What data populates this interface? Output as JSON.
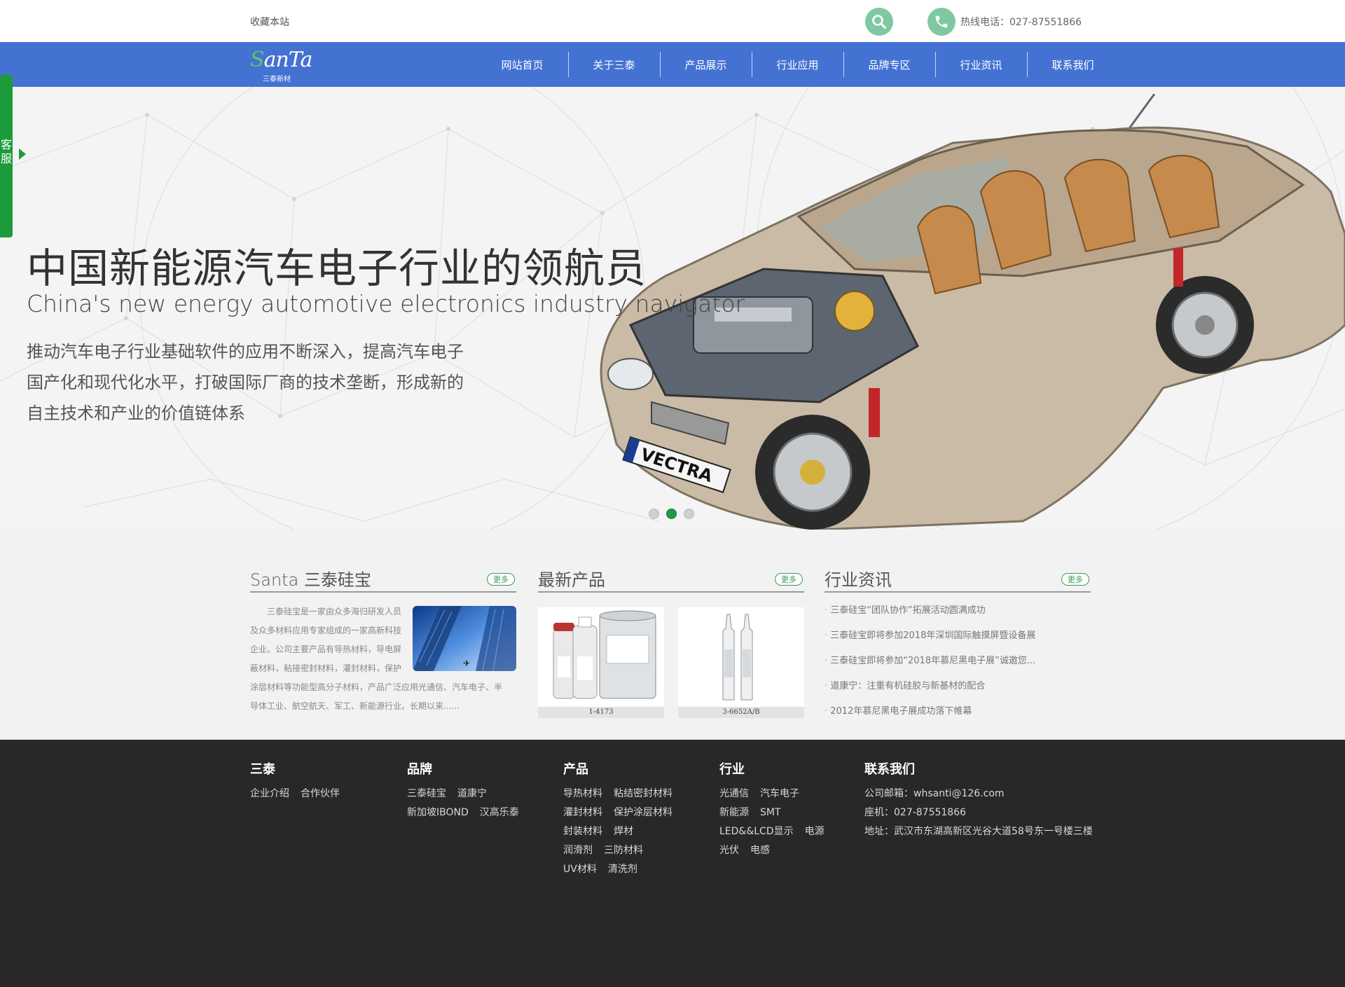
{
  "topbar": {
    "favorite": "收藏本站",
    "hotline": "热线电话：027-87551866"
  },
  "brand": {
    "logo_text": "SanTa",
    "logo_sub": "三泰新材"
  },
  "nav": {
    "items": [
      "网站首页",
      "关于三泰",
      "产品展示",
      "行业应用",
      "品牌专区",
      "行业资讯",
      "联系我们"
    ]
  },
  "side_service": {
    "label": "客服"
  },
  "hero": {
    "title": "中国新能源汽车电子行业的领航员",
    "subtitle": "China's new energy automotive electronics industry navigator",
    "desc_lines": [
      "推动汽车电子行业基础软件的应用不断深入，提高汽车电子",
      "国产化和现代化水平，打破国际厂商的技术垄断，形成新的",
      "自主技术和产业的价值链体系"
    ],
    "car_plate": "VECTRA",
    "slides": 3,
    "active_slide": 2
  },
  "about": {
    "title": "Santa 三泰硅宝",
    "more": "更多",
    "text": "三泰硅宝是一家由众多海归研发人员及众多材料应用专家组成的一家高新科技企业。公司主要产品有导热材料，导电屏蔽材料，粘接密封材料，灌封材料，保护涂层材料等功能型高分子材料，产品广泛应用光通信、汽车电子、半导体工业、航空航天、军工、新能源行业。长期以来......"
  },
  "products": {
    "title": "最新产品",
    "more": "更多",
    "items": [
      {
        "caption": "1-4173"
      },
      {
        "caption": "3-6652A/B"
      }
    ]
  },
  "news": {
    "title": "行业资讯",
    "more": "更多",
    "items": [
      "三泰硅宝“团队协作”拓展活动圆满成功",
      "三泰硅宝即将参加2018年深圳国际触摸屏暨设备展",
      "三泰硅宝即将参加“2018年慕尼黑电子展”诚邀您...",
      "道康宁：注重有机硅胶与新基材的配合",
      "2012年慕尼黑电子展成功落下帷幕"
    ]
  },
  "footer": {
    "sections": [
      {
        "title": "三泰",
        "rows": [
          [
            "企业介绍",
            "合作伙伴"
          ]
        ]
      },
      {
        "title": "品牌",
        "rows": [
          [
            "三泰硅宝",
            "道康宁"
          ],
          [
            "新加坡IBOND",
            "汉高乐泰"
          ]
        ]
      },
      {
        "title": "产品",
        "rows": [
          [
            "导热材料",
            "粘结密封材料"
          ],
          [
            "灌封材料",
            "保护涂层材料"
          ],
          [
            "封装材料",
            "焊材"
          ],
          [
            "润滑剂",
            "三防材料"
          ],
          [
            "UV材料",
            "清洗剂"
          ]
        ]
      },
      {
        "title": "行业",
        "rows": [
          [
            "光通信",
            "汽车电子"
          ],
          [
            "新能源",
            "SMT"
          ],
          [
            "LED&&LCD显示",
            "电源"
          ],
          [
            "光伏",
            "电感"
          ]
        ]
      }
    ],
    "contact": {
      "title": "联系我们",
      "email": "公司邮箱：whsanti@126.com",
      "phone": "座机：027-87551866",
      "address": "地址：武汉市东湖高新区光谷大道58号东一号楼三楼"
    }
  },
  "colors": {
    "nav_bg": "#4472d3",
    "accent_green": "#1c9b3b",
    "footer_bg": "#282828",
    "content_bg": "#f2f2f2"
  }
}
